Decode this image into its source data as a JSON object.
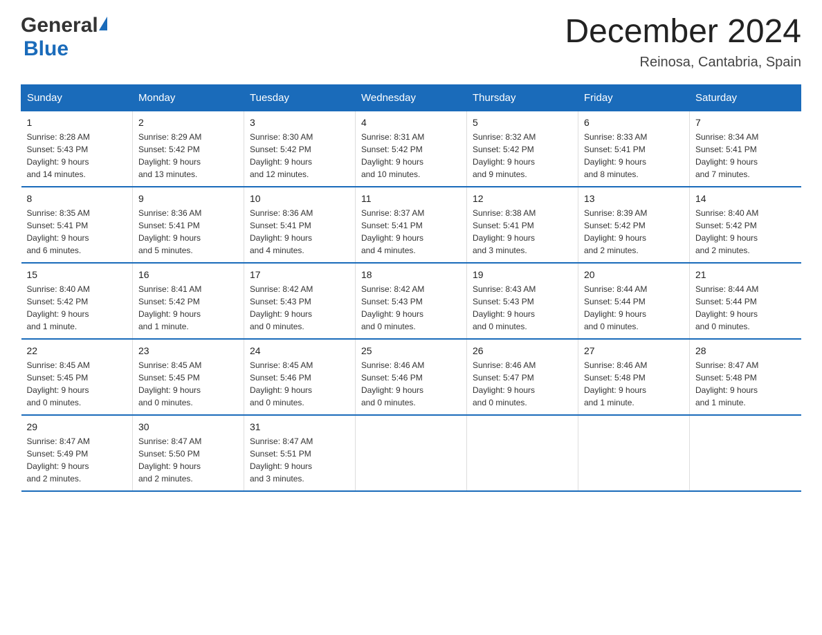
{
  "header": {
    "logo_general": "General",
    "logo_blue": "Blue",
    "month_title": "December 2024",
    "location": "Reinosa, Cantabria, Spain"
  },
  "days_of_week": [
    "Sunday",
    "Monday",
    "Tuesday",
    "Wednesday",
    "Thursday",
    "Friday",
    "Saturday"
  ],
  "weeks": [
    [
      {
        "day": "1",
        "sunrise": "8:28 AM",
        "sunset": "5:43 PM",
        "daylight": "9 hours and 14 minutes."
      },
      {
        "day": "2",
        "sunrise": "8:29 AM",
        "sunset": "5:42 PM",
        "daylight": "9 hours and 13 minutes."
      },
      {
        "day": "3",
        "sunrise": "8:30 AM",
        "sunset": "5:42 PM",
        "daylight": "9 hours and 12 minutes."
      },
      {
        "day": "4",
        "sunrise": "8:31 AM",
        "sunset": "5:42 PM",
        "daylight": "9 hours and 10 minutes."
      },
      {
        "day": "5",
        "sunrise": "8:32 AM",
        "sunset": "5:42 PM",
        "daylight": "9 hours and 9 minutes."
      },
      {
        "day": "6",
        "sunrise": "8:33 AM",
        "sunset": "5:41 PM",
        "daylight": "9 hours and 8 minutes."
      },
      {
        "day": "7",
        "sunrise": "8:34 AM",
        "sunset": "5:41 PM",
        "daylight": "9 hours and 7 minutes."
      }
    ],
    [
      {
        "day": "8",
        "sunrise": "8:35 AM",
        "sunset": "5:41 PM",
        "daylight": "9 hours and 6 minutes."
      },
      {
        "day": "9",
        "sunrise": "8:36 AM",
        "sunset": "5:41 PM",
        "daylight": "9 hours and 5 minutes."
      },
      {
        "day": "10",
        "sunrise": "8:36 AM",
        "sunset": "5:41 PM",
        "daylight": "9 hours and 4 minutes."
      },
      {
        "day": "11",
        "sunrise": "8:37 AM",
        "sunset": "5:41 PM",
        "daylight": "9 hours and 4 minutes."
      },
      {
        "day": "12",
        "sunrise": "8:38 AM",
        "sunset": "5:41 PM",
        "daylight": "9 hours and 3 minutes."
      },
      {
        "day": "13",
        "sunrise": "8:39 AM",
        "sunset": "5:42 PM",
        "daylight": "9 hours and 2 minutes."
      },
      {
        "day": "14",
        "sunrise": "8:40 AM",
        "sunset": "5:42 PM",
        "daylight": "9 hours and 2 minutes."
      }
    ],
    [
      {
        "day": "15",
        "sunrise": "8:40 AM",
        "sunset": "5:42 PM",
        "daylight": "9 hours and 1 minute."
      },
      {
        "day": "16",
        "sunrise": "8:41 AM",
        "sunset": "5:42 PM",
        "daylight": "9 hours and 1 minute."
      },
      {
        "day": "17",
        "sunrise": "8:42 AM",
        "sunset": "5:43 PM",
        "daylight": "9 hours and 0 minutes."
      },
      {
        "day": "18",
        "sunrise": "8:42 AM",
        "sunset": "5:43 PM",
        "daylight": "9 hours and 0 minutes."
      },
      {
        "day": "19",
        "sunrise": "8:43 AM",
        "sunset": "5:43 PM",
        "daylight": "9 hours and 0 minutes."
      },
      {
        "day": "20",
        "sunrise": "8:44 AM",
        "sunset": "5:44 PM",
        "daylight": "9 hours and 0 minutes."
      },
      {
        "day": "21",
        "sunrise": "8:44 AM",
        "sunset": "5:44 PM",
        "daylight": "9 hours and 0 minutes."
      }
    ],
    [
      {
        "day": "22",
        "sunrise": "8:45 AM",
        "sunset": "5:45 PM",
        "daylight": "9 hours and 0 minutes."
      },
      {
        "day": "23",
        "sunrise": "8:45 AM",
        "sunset": "5:45 PM",
        "daylight": "9 hours and 0 minutes."
      },
      {
        "day": "24",
        "sunrise": "8:45 AM",
        "sunset": "5:46 PM",
        "daylight": "9 hours and 0 minutes."
      },
      {
        "day": "25",
        "sunrise": "8:46 AM",
        "sunset": "5:46 PM",
        "daylight": "9 hours and 0 minutes."
      },
      {
        "day": "26",
        "sunrise": "8:46 AM",
        "sunset": "5:47 PM",
        "daylight": "9 hours and 0 minutes."
      },
      {
        "day": "27",
        "sunrise": "8:46 AM",
        "sunset": "5:48 PM",
        "daylight": "9 hours and 1 minute."
      },
      {
        "day": "28",
        "sunrise": "8:47 AM",
        "sunset": "5:48 PM",
        "daylight": "9 hours and 1 minute."
      }
    ],
    [
      {
        "day": "29",
        "sunrise": "8:47 AM",
        "sunset": "5:49 PM",
        "daylight": "9 hours and 2 minutes."
      },
      {
        "day": "30",
        "sunrise": "8:47 AM",
        "sunset": "5:50 PM",
        "daylight": "9 hours and 2 minutes."
      },
      {
        "day": "31",
        "sunrise": "8:47 AM",
        "sunset": "5:51 PM",
        "daylight": "9 hours and 3 minutes."
      },
      null,
      null,
      null,
      null
    ]
  ],
  "labels": {
    "sunrise": "Sunrise:",
    "sunset": "Sunset:",
    "daylight": "Daylight:"
  }
}
